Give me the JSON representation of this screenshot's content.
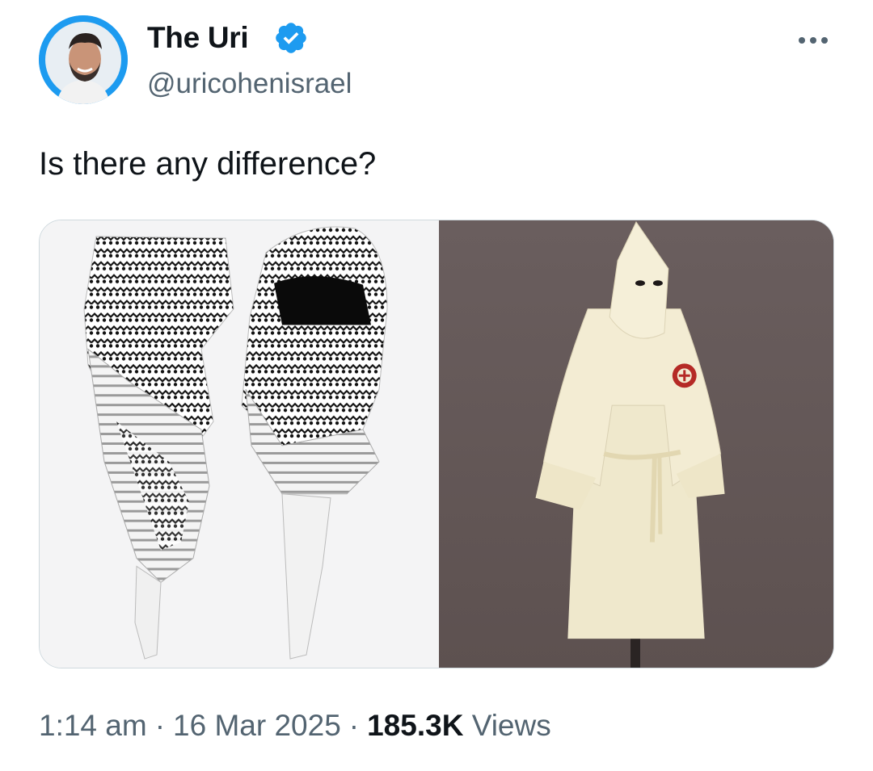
{
  "author": {
    "display_name": "The Uri",
    "handle": "@uricohenisrael",
    "verified": true,
    "avatar_icon": "profile-photo",
    "badge_color": "#1d9bf0"
  },
  "menu": {
    "icon": "more-horizontal-icon"
  },
  "tweet": {
    "text": "Is there any difference?"
  },
  "media": {
    "left_image": "keffiyeh-scarves-photo",
    "right_image": "white-hooded-robe-photo"
  },
  "footer": {
    "time": "1:14 am",
    "separator": "·",
    "date": "16 Mar 2025",
    "views_count": "185.3K",
    "views_label": "Views"
  },
  "colors": {
    "text": "#0f1419",
    "secondary": "#536471",
    "border": "#cfd9de"
  }
}
